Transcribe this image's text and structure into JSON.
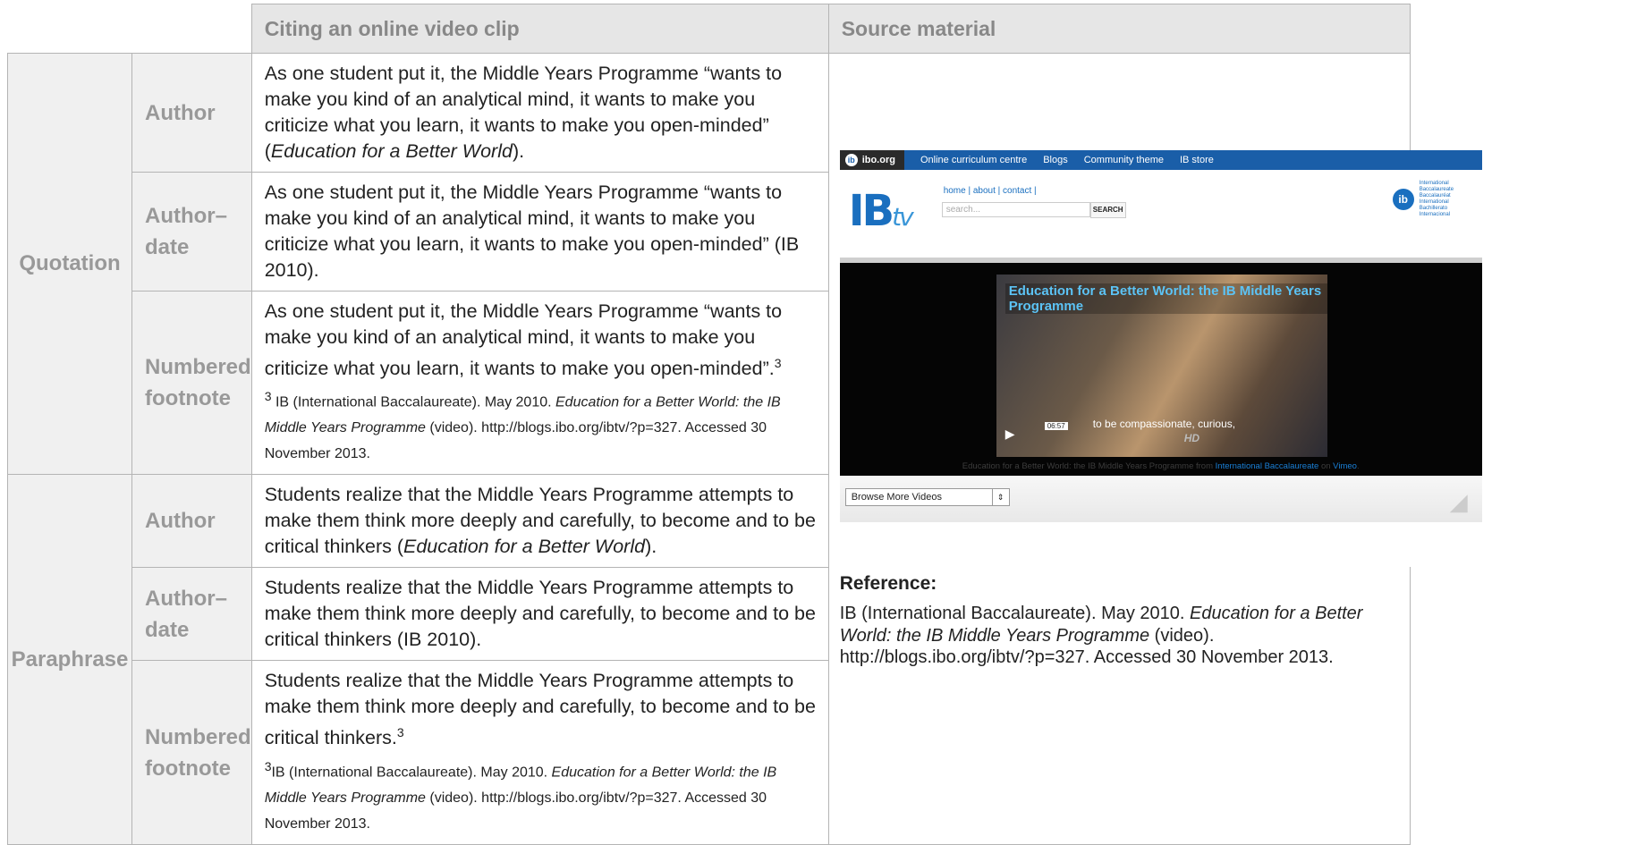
{
  "headers": {
    "citing": "Citing an online video clip",
    "source": "Source material"
  },
  "categories": {
    "quotation": "Quotation",
    "paraphrase": "Paraphrase"
  },
  "subs": {
    "author": "Author",
    "author_date": "Author– date",
    "numbered_footnote": "Numbered footnote"
  },
  "quotation": {
    "author": {
      "before": "As one student put it, the Middle Years Programme “wants to make you kind of an analytical mind, it wants to make you criticize what you learn, it wants to make you open-minded” (",
      "italic": "Education for a Better World",
      "after": ")."
    },
    "author_date": "As one student put it, the Middle Years Programme “wants to make you kind of an analytical mind, it wants to make you criticize what you learn, it wants to make you open-minded” (IB 2010).",
    "footnote": {
      "text": "As one student put it, the Middle Years Programme “wants to make you kind of an analytical mind, it wants to make you criticize what you learn, it wants to make you open-minded”.",
      "sup": "3"
    }
  },
  "paraphrase": {
    "author": {
      "before": "Students realize that the Middle Years Programme attempts to make them think more deeply and carefully, to become and to be critical thinkers (",
      "italic": "Education for a Better World",
      "after": ")."
    },
    "author_date": "Students realize that the Middle Years Programme attempts to make them think more deeply and carefully, to become and to be critical thinkers (IB 2010).",
    "footnote": {
      "text": "Students realize that the Middle Years Programme attempts to make them think more deeply and carefully, to become and to be critical thinkers.",
      "sup": "3"
    }
  },
  "footnote_note": {
    "num": "3",
    "before": "IB (International Baccalaureate). May 2010. ",
    "italic": "Education for a Better World: the IB Middle Years Programme",
    "after": " (video). http://blogs.ibo.org/ibtv/?p=327. Accessed 30 November 2013."
  },
  "widget": {
    "nav": [
      "ibo.org",
      "Online curriculum centre",
      "Blogs",
      "Community theme",
      "IB store"
    ],
    "logo_ib": "IB",
    "logo_tv": "tv",
    "links": "home | about | contact |",
    "search_placeholder": "search...",
    "search_button": "SEARCH",
    "brand_lines": "International Baccalaureate Baccalauréat International Bachillerato Internacional",
    "video_title": "Education for a Better World: the IB Middle Years Programme",
    "caption": "to be compassionate, curious,",
    "time": "06:57",
    "hd": "HD",
    "credit_prefix": "Education for a Better World: the IB Middle Years Programme from ",
    "credit_link": "International Baccalaureate",
    "credit_on": " on ",
    "credit_vimeo": "Vimeo",
    "browse_label": "Browse More Videos"
  },
  "reference": {
    "heading": "Reference:",
    "before": "IB (International Baccalaureate). May 2010. ",
    "italic": "Education for a Better World: the IB Middle Years Programme",
    "after": " (video). http://blogs.ibo.org/ibtv/?p=327. Accessed 30 November 2013."
  }
}
